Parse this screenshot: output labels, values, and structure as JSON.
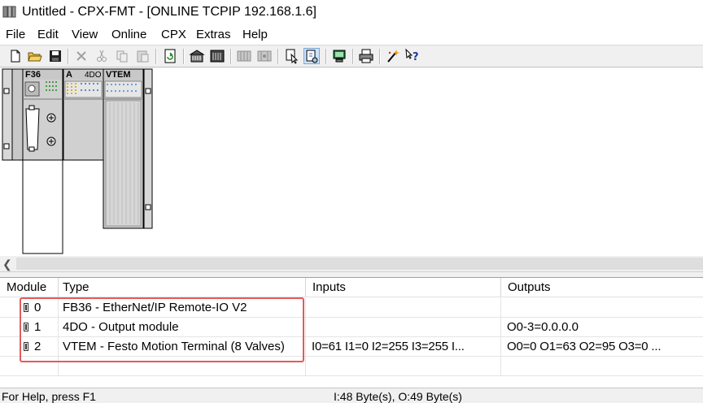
{
  "window": {
    "title": "Untitled - CPX-FMT - [ONLINE TCPIP 192.168.1.6]"
  },
  "menu": {
    "items": [
      "File",
      "Edit",
      "View",
      "Online",
      "CPX",
      "Extras",
      "Help"
    ]
  },
  "toolbar": {
    "buttons": [
      "new-file-icon",
      "open-folder-icon",
      "save-icon",
      "cut-x-icon",
      "cut-icon",
      "copy-icon",
      "paste-icon",
      "refresh-icon",
      "module-list-icon",
      "module-config-icon",
      "module-a-icon",
      "module-b-icon",
      "select-pointer-icon",
      "online-diagnosis-icon",
      "monitor-icon",
      "print-icon",
      "wand-icon",
      "help-pointer-icon"
    ],
    "active_button": "online-diagnosis-icon"
  },
  "modules": [
    {
      "label": "F36"
    },
    {
      "label": "A",
      "sublabel": "4DO"
    },
    {
      "label": "VTEM"
    }
  ],
  "table": {
    "headers": [
      "Module",
      "Type",
      "Inputs",
      "Outputs"
    ],
    "rows": [
      {
        "module": "0",
        "type": "FB36 - EtherNet/IP Remote-IO V2",
        "inputs": "",
        "outputs": ""
      },
      {
        "module": "1",
        "type": "4DO - Output module",
        "inputs": "",
        "outputs": "O0-3=0.0.0.0"
      },
      {
        "module": "2",
        "type": "VTEM - Festo Motion Terminal (8 Valves)",
        "inputs": "I0=61  I1=0  I2=255  I3=255  I...",
        "outputs": "O0=0  O1=63  O2=95  O3=0  ..."
      }
    ]
  },
  "status": {
    "help": "For Help, press F1",
    "io": "I:48 Byte(s), O:49 Byte(s)"
  },
  "colors": {
    "highlight": "#e15c5c",
    "active_button": "#cde4f7"
  }
}
